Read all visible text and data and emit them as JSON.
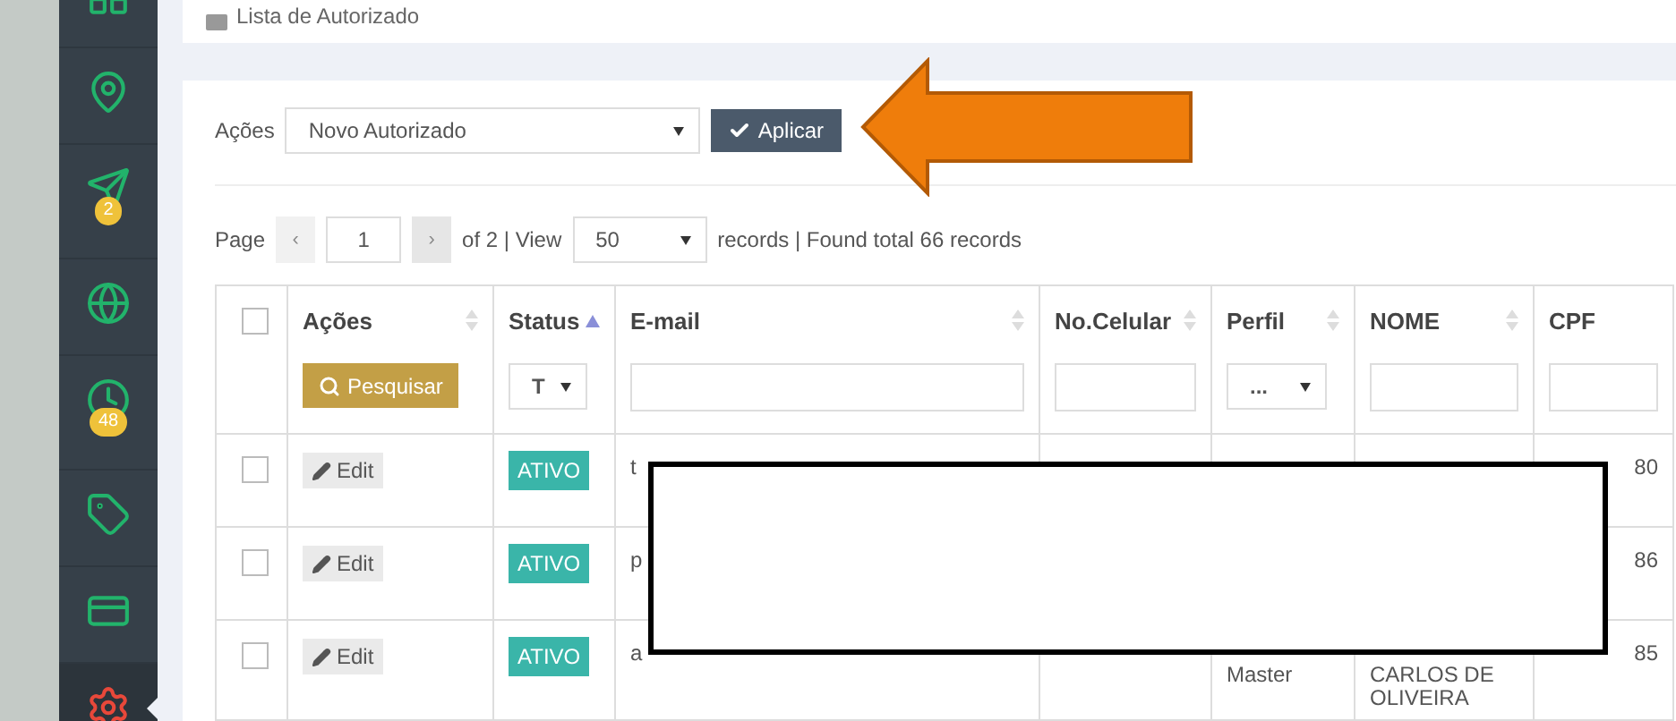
{
  "sidebar": {
    "items": [
      {
        "kind": "grid",
        "selected": false
      },
      {
        "kind": "pin",
        "selected": false
      },
      {
        "kind": "send",
        "selected": false,
        "badge": "2"
      },
      {
        "kind": "globe",
        "selected": false
      },
      {
        "kind": "clock",
        "selected": false,
        "badge": "48"
      },
      {
        "kind": "tag",
        "selected": false
      },
      {
        "kind": "card",
        "selected": false
      },
      {
        "kind": "gear",
        "selected": true
      }
    ]
  },
  "breadcrumb": {
    "title": "Lista de Autorizado"
  },
  "actions_bar": {
    "label": "Ações",
    "select_value": "Novo Autorizado",
    "button": "Aplicar"
  },
  "pager": {
    "page_label": "Page",
    "prev": "‹",
    "page": "1",
    "next": "›",
    "of_view": "of 2 | View",
    "view": "50",
    "summary": "records | Found total 66 records"
  },
  "table": {
    "select_all_checked": false,
    "columns": [
      {
        "label": "Ações",
        "sorted": false,
        "kind": "button",
        "filter_text": "Pesquisar"
      },
      {
        "label": "Status",
        "sorted": true,
        "kind": "select",
        "filter_text": "T"
      },
      {
        "label": "E-mail",
        "sorted": false,
        "kind": "input"
      },
      {
        "label": "No.Celular",
        "sorted": false,
        "kind": "input"
      },
      {
        "label": "Perfil",
        "sorted": false,
        "kind": "select",
        "filter_text": "..."
      },
      {
        "label": "NOME",
        "sorted": false,
        "kind": "input"
      },
      {
        "label": "CPF",
        "kind": "input"
      }
    ],
    "rows": [
      {
        "checked": false,
        "edit": "Edit",
        "status": "ATIVO",
        "email": "t",
        "cpf": "80"
      },
      {
        "checked": false,
        "edit": "Edit",
        "status": "ATIVO",
        "email": "p",
        "cpf": "86"
      },
      {
        "checked": false,
        "edit": "Edit",
        "status": "ATIVO",
        "email": "a",
        "perfil": "Master",
        "nome": "CARLOS DE OLIVEIRA",
        "cpf": "85"
      }
    ]
  }
}
